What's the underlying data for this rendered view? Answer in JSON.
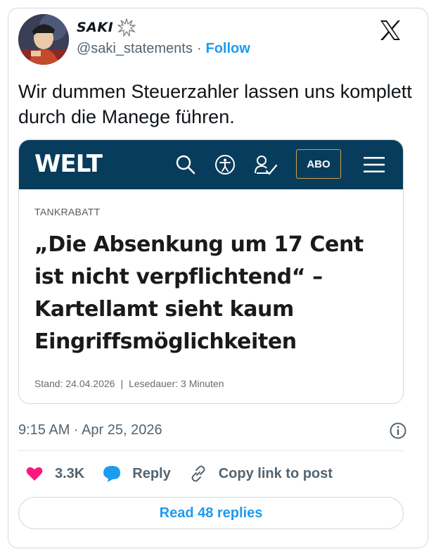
{
  "author": {
    "display_name": "SAKI",
    "handle": "@saki_statements",
    "separator": "·",
    "follow_label": "Follow"
  },
  "tweet": {
    "text": "Wir dummen Steuerzahler lassen uns komplett durch die Manege führen.",
    "timestamp": "9:15 AM · Apr 25, 2026"
  },
  "embed": {
    "brand": "WELT",
    "abo_label": "ABO",
    "kicker": "TANKRABATT",
    "headline": "„Die Absenkung um 17 Cent ist nicht verpflichtend“ – Kartellamt sieht kaum Eingriffsmöglichkeiten",
    "stand": "Stand: 24.04.2026",
    "meta_separator": "|",
    "lesedauer": "Lesedauer: 3 Minuten",
    "colors": {
      "bar": "#083c5c",
      "abo_border": "#d4a14a"
    }
  },
  "actions": {
    "like_count": "3.3K",
    "reply_label": "Reply",
    "copy_label": "Copy link to post",
    "read_replies_label": "Read 48 replies"
  },
  "colors": {
    "accent": "#1d9bf0",
    "like": "#f91880",
    "muted": "#536471"
  },
  "icons": [
    "burst-icon",
    "x-logo-icon",
    "search-icon",
    "accessibility-icon",
    "signature-icon",
    "menu-icon",
    "info-icon",
    "heart-icon",
    "reply-bubble-icon",
    "link-icon"
  ]
}
